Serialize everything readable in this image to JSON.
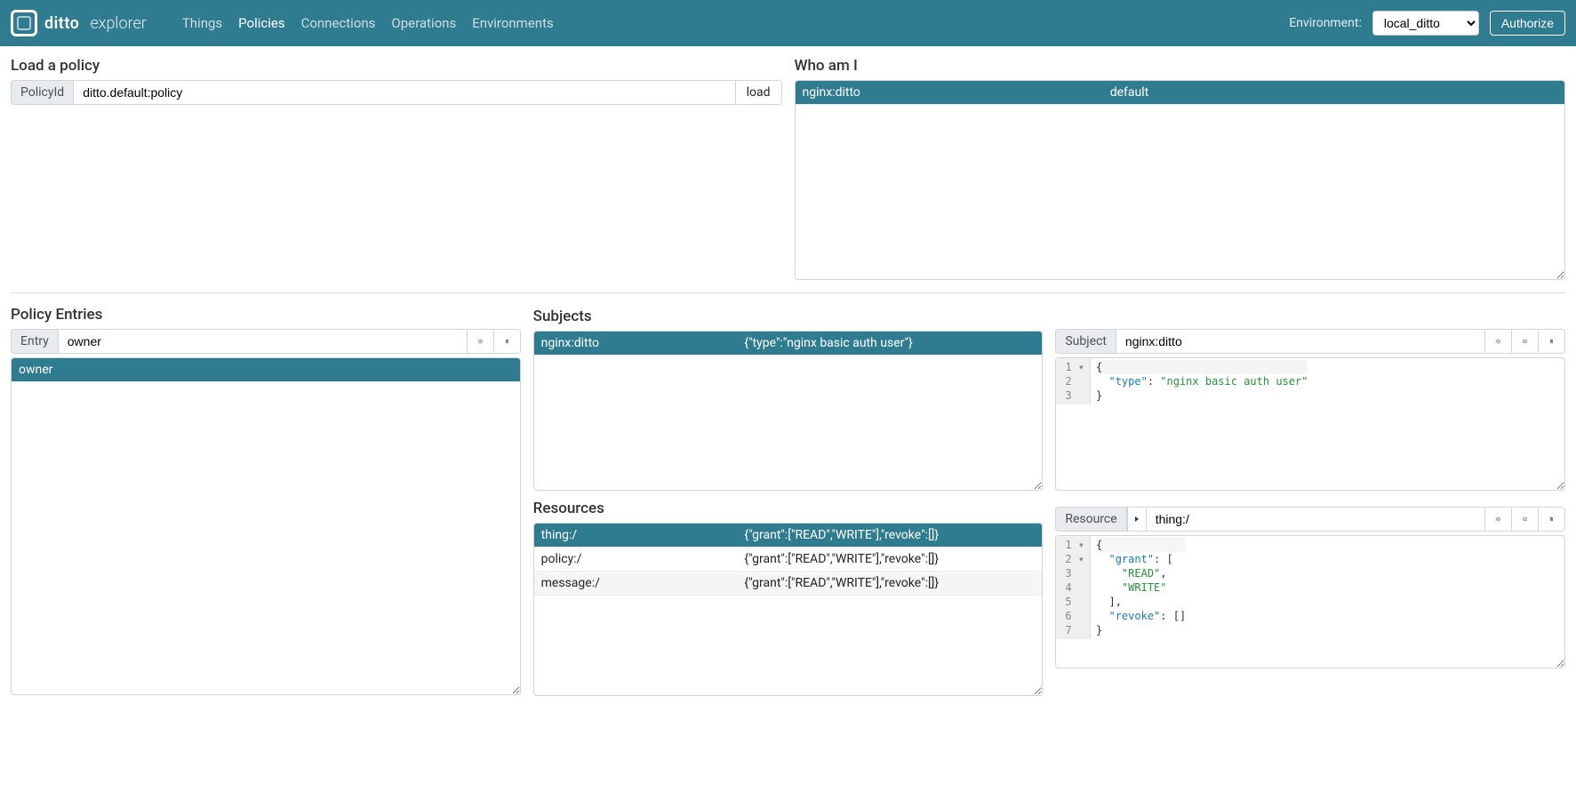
{
  "nav": {
    "brand_ditto": "ditto",
    "brand_sub": "explorer",
    "links": [
      "Things",
      "Policies",
      "Connections",
      "Operations",
      "Environments"
    ],
    "active_index": 1,
    "env_label": "Environment:",
    "env_value": "local_ditto",
    "authorize": "Authorize"
  },
  "load_policy": {
    "heading": "Load a policy",
    "addon": "PolicyId",
    "value": "ditto.default:policy",
    "button": "load"
  },
  "whoami": {
    "heading": "Who am I",
    "rows": [
      {
        "col1": "nginx:ditto",
        "col2": "default",
        "selected": true
      }
    ]
  },
  "entries": {
    "heading": "Policy Entries",
    "addon": "Entry",
    "value": "owner",
    "list": [
      {
        "label": "owner",
        "selected": true
      }
    ]
  },
  "subjects": {
    "heading": "Subjects",
    "rows": [
      {
        "col1": "nginx:ditto",
        "col2": "{\"type\":\"nginx basic auth user\"}",
        "selected": true
      }
    ]
  },
  "resources": {
    "heading": "Resources",
    "rows": [
      {
        "col1": "thing:/",
        "col2": "{\"grant\":[\"READ\",\"WRITE\"],\"revoke\":[]}",
        "selected": true
      },
      {
        "col1": "policy:/",
        "col2": "{\"grant\":[\"READ\",\"WRITE\"],\"revoke\":[]}",
        "selected": false
      },
      {
        "col1": "message:/",
        "col2": "{\"grant\":[\"READ\",\"WRITE\"],\"revoke\":[]}",
        "selected": false,
        "stripe": true
      }
    ]
  },
  "subject_editor": {
    "addon": "Subject",
    "value": "nginx:ditto",
    "code": {
      "line_numbers": [
        "1",
        "2",
        "3"
      ],
      "folds": [
        "▾",
        "",
        ""
      ],
      "tokens": [
        [
          {
            "t": "brace",
            "v": "{"
          }
        ],
        [
          {
            "t": "pad",
            "v": "  "
          },
          {
            "t": "key",
            "v": "\"type\""
          },
          {
            "t": "punc",
            "v": ": "
          },
          {
            "t": "str",
            "v": "\"nginx basic auth user\""
          }
        ],
        [
          {
            "t": "brace",
            "v": "}"
          }
        ]
      ]
    }
  },
  "resource_editor": {
    "addon": "Resource",
    "value": "thing:/",
    "code": {
      "line_numbers": [
        "1",
        "2",
        "3",
        "4",
        "5",
        "6",
        "7"
      ],
      "folds": [
        "▾",
        "▾",
        "",
        "",
        "",
        "",
        ""
      ],
      "tokens": [
        [
          {
            "t": "brace",
            "v": "{"
          }
        ],
        [
          {
            "t": "pad",
            "v": "  "
          },
          {
            "t": "key",
            "v": "\"grant\""
          },
          {
            "t": "punc",
            "v": ": ["
          }
        ],
        [
          {
            "t": "pad",
            "v": "    "
          },
          {
            "t": "str",
            "v": "\"READ\""
          },
          {
            "t": "punc",
            "v": ","
          }
        ],
        [
          {
            "t": "pad",
            "v": "    "
          },
          {
            "t": "str",
            "v": "\"WRITE\""
          }
        ],
        [
          {
            "t": "pad",
            "v": "  "
          },
          {
            "t": "punc",
            "v": "],"
          }
        ],
        [
          {
            "t": "pad",
            "v": "  "
          },
          {
            "t": "key",
            "v": "\"revoke\""
          },
          {
            "t": "punc",
            "v": ": []"
          }
        ],
        [
          {
            "t": "brace",
            "v": "}"
          }
        ]
      ]
    }
  }
}
